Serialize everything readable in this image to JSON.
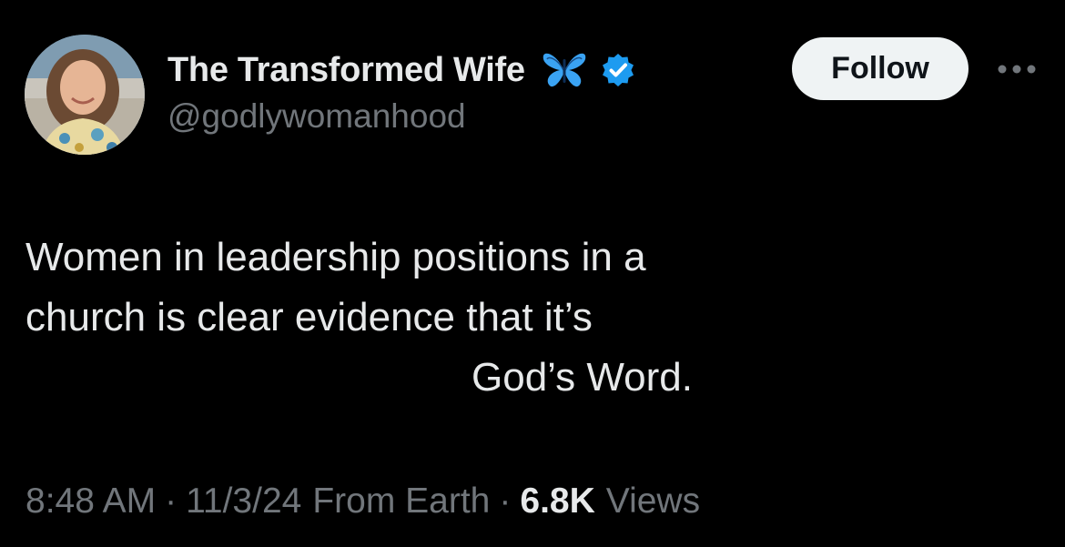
{
  "author": {
    "display_name": "The Transformed Wife",
    "handle": "@godlywomanhood",
    "name_emoji": "butterfly-icon",
    "verified_badge": "verified-icon",
    "verified_color": "#1d9bf0",
    "butterfly_color": "#3aa3f3"
  },
  "actions": {
    "follow_label": "Follow",
    "more_icon": "more-horizontal-icon"
  },
  "tweet": {
    "text_lines": [
      "Women in leadership positions in a",
      "church is clear evidence that it’s",
      "God’s Word."
    ]
  },
  "meta": {
    "time": "8:48 AM",
    "separator": "·",
    "date": "11/3/24",
    "source": "From Earth",
    "views_count": "6.8K",
    "views_label": "Views"
  },
  "colors": {
    "background": "#000000",
    "primary_text": "#e7e9ea",
    "secondary_text": "#71767b",
    "follow_bg": "#eff3f4",
    "follow_text": "#0f1419"
  }
}
